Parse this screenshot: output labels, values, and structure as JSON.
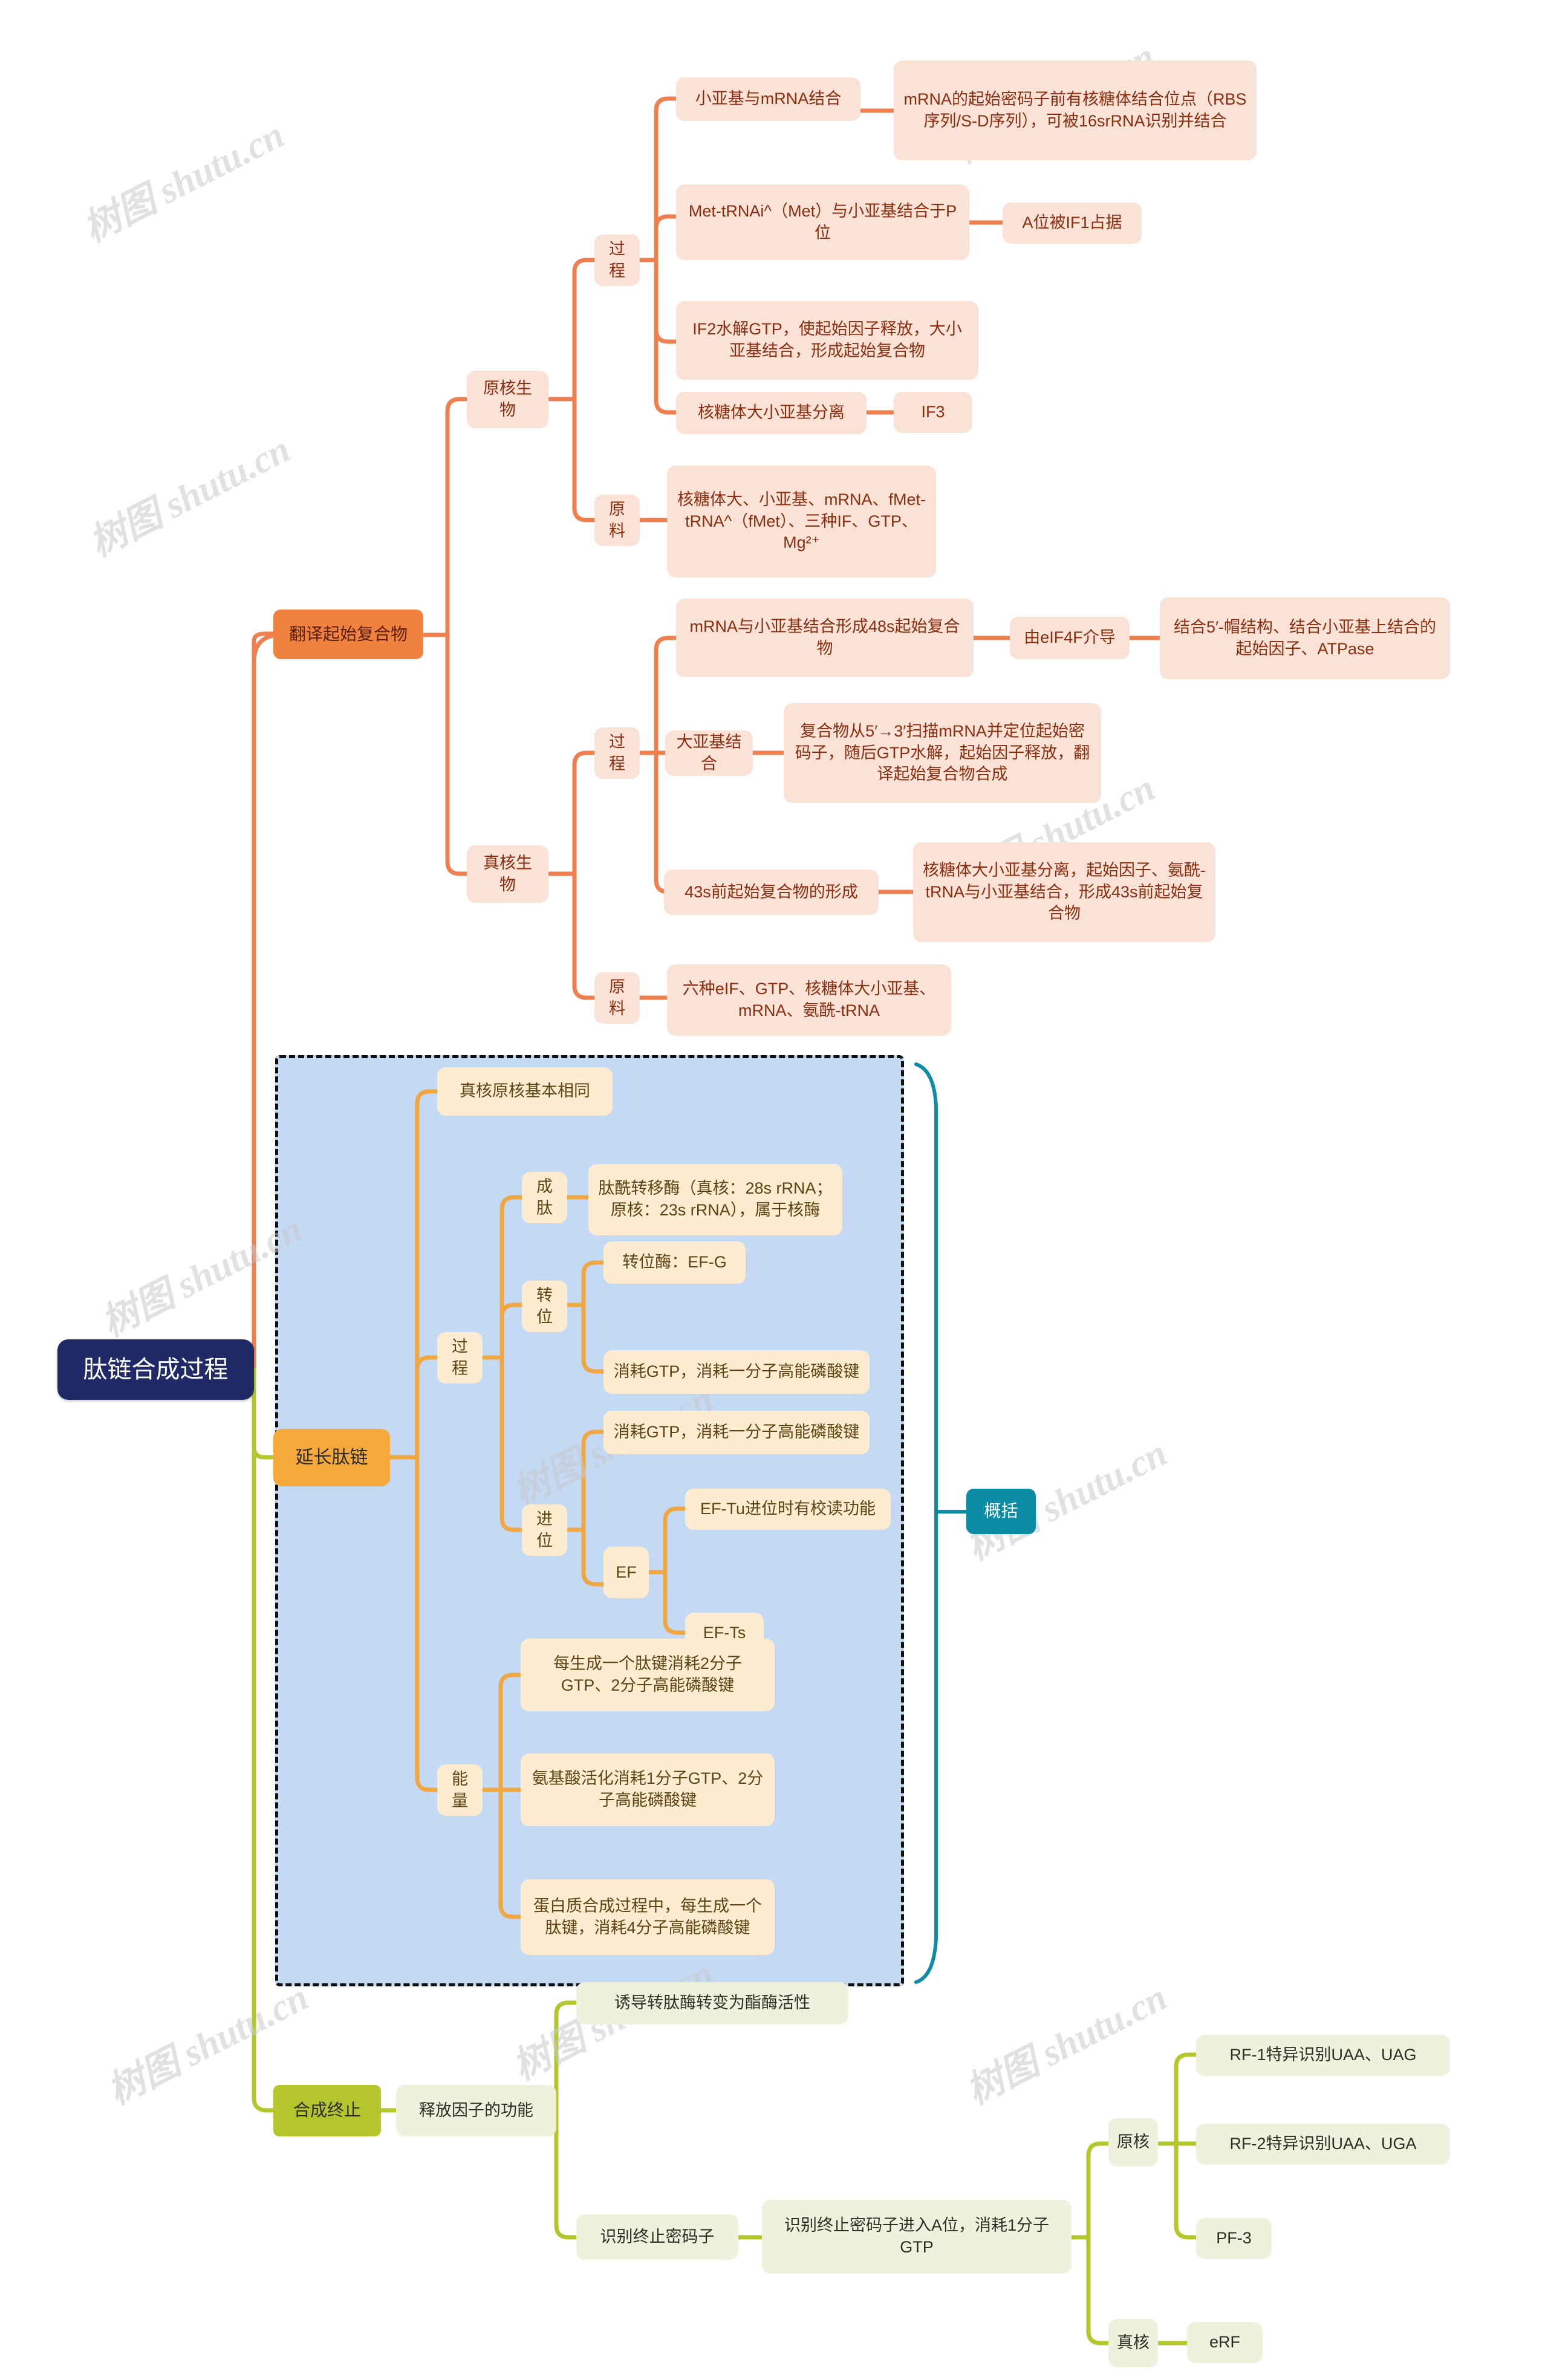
{
  "root": {
    "label": "肽链合成过程"
  },
  "branches": [
    {
      "id": "initiation",
      "label": "翻译起始复合物",
      "color": "#f1813f",
      "children": [
        {
          "label": "原核生物",
          "children": [
            {
              "label": "过程",
              "children": [
                {
                  "label": "小亚基与mRNA结合",
                  "children": [
                    {
                      "label": "mRNA的起始密码子前有核糖体结合位点（RBS序列/S-D序列），可被16srRNA识别并结合"
                    }
                  ]
                },
                {
                  "label": "Met-tRNAi^（Met）与小亚基结合于P位",
                  "children": [
                    {
                      "label": "A位被IF1占据"
                    }
                  ]
                },
                {
                  "label": "IF2水解GTP，使起始因子释放，大小亚基结合，形成起始复合物"
                },
                {
                  "label": "核糖体大小亚基分离",
                  "children": [
                    {
                      "label": "IF3"
                    }
                  ]
                }
              ]
            },
            {
              "label": "原料",
              "children": [
                {
                  "label": "核糖体大、小亚基、mRNA、fMet-tRNA^（fMet）、三种IF、GTP、Mg²⁺"
                }
              ]
            }
          ]
        },
        {
          "label": "真核生物",
          "children": [
            {
              "label": "过程",
              "children": [
                {
                  "label": "mRNA与小亚基结合形成48s起始复合物",
                  "children": [
                    {
                      "label": "由eIF4F介导",
                      "children": [
                        {
                          "label": "结合5′-帽结构、结合小亚基上结合的起始因子、ATPase"
                        }
                      ]
                    }
                  ]
                },
                {
                  "label": "大亚基结合",
                  "children": [
                    {
                      "label": "复合物从5′→3′扫描mRNA并定位起始密码子，随后GTP水解，起始因子释放，翻译起始复合物合成"
                    }
                  ]
                },
                {
                  "label": "43s前起始复合物的形成",
                  "children": [
                    {
                      "label": "核糖体大小亚基分离，起始因子、氨酰-tRNA与小亚基结合，形成43s前起始复合物"
                    }
                  ]
                }
              ]
            },
            {
              "label": "原料",
              "children": [
                {
                  "label": "六种eIF、GTP、核糖体大小亚基、mRNA、氨酰-tRNA"
                }
              ]
            }
          ]
        }
      ]
    },
    {
      "id": "elongation",
      "label": "延长肽链",
      "color": "#f6a93b",
      "children": [
        {
          "label": "真核原核基本相同"
        },
        {
          "label": "过程",
          "children": [
            {
              "label": "成肽",
              "children": [
                {
                  "label": "肽酰转移酶（真核：28s rRNA；原核：23s rRNA），属于核酶"
                }
              ]
            },
            {
              "label": "转位",
              "children": [
                {
                  "label": "转位酶：EF-G"
                },
                {
                  "label": "消耗GTP，消耗一分子高能磷酸键"
                }
              ]
            },
            {
              "label": "进位",
              "children": [
                {
                  "label": "消耗GTP，消耗一分子高能磷酸键"
                },
                {
                  "label": "EF",
                  "children": [
                    {
                      "label": "EF-Tu进位时有校读功能"
                    },
                    {
                      "label": "EF-Ts"
                    }
                  ]
                }
              ]
            }
          ]
        },
        {
          "label": "能量",
          "children": [
            {
              "label": "每生成一个肽键消耗2分子GTP、2分子高能磷酸键"
            },
            {
              "label": "氨基酸活化消耗1分子GTP、2分子高能磷酸键"
            },
            {
              "label": "蛋白质合成过程中，每生成一个肽键，消耗4分子高能磷酸键"
            }
          ]
        }
      ]
    },
    {
      "id": "termination",
      "label": "合成终止",
      "color": "#b4c62c",
      "children": [
        {
          "label": "释放因子的功能",
          "children": [
            {
              "label": "诱导转肽酶转变为酯酶活性"
            },
            {
              "label": "识别终止密码子",
              "children": [
                {
                  "label": "识别终止密码子进入A位，消耗1分子GTP",
                  "children": [
                    {
                      "label": "原核",
                      "children": [
                        {
                          "label": "RF-1特异识别UAA、UAG"
                        },
                        {
                          "label": "RF-2特异识别UAA、UGA"
                        },
                        {
                          "label": "PF-3"
                        }
                      ]
                    },
                    {
                      "label": "真核",
                      "children": [
                        {
                          "label": "eRF"
                        }
                      ]
                    }
                  ]
                }
              ]
            }
          ]
        }
      ]
    }
  ],
  "annotation": {
    "label": "概括",
    "color": "#0d8ca8"
  },
  "watermark": {
    "text": "树图 shutu.cn"
  },
  "palette": {
    "root_bg": "#1f2a66",
    "orange_line": "#ef7f4e",
    "amber_line": "#f0a741",
    "olive_line": "#b4c62c",
    "teal": "#0d8ca8",
    "highlight_fill": "#c4d9f4",
    "highlight_border": "#111111"
  }
}
